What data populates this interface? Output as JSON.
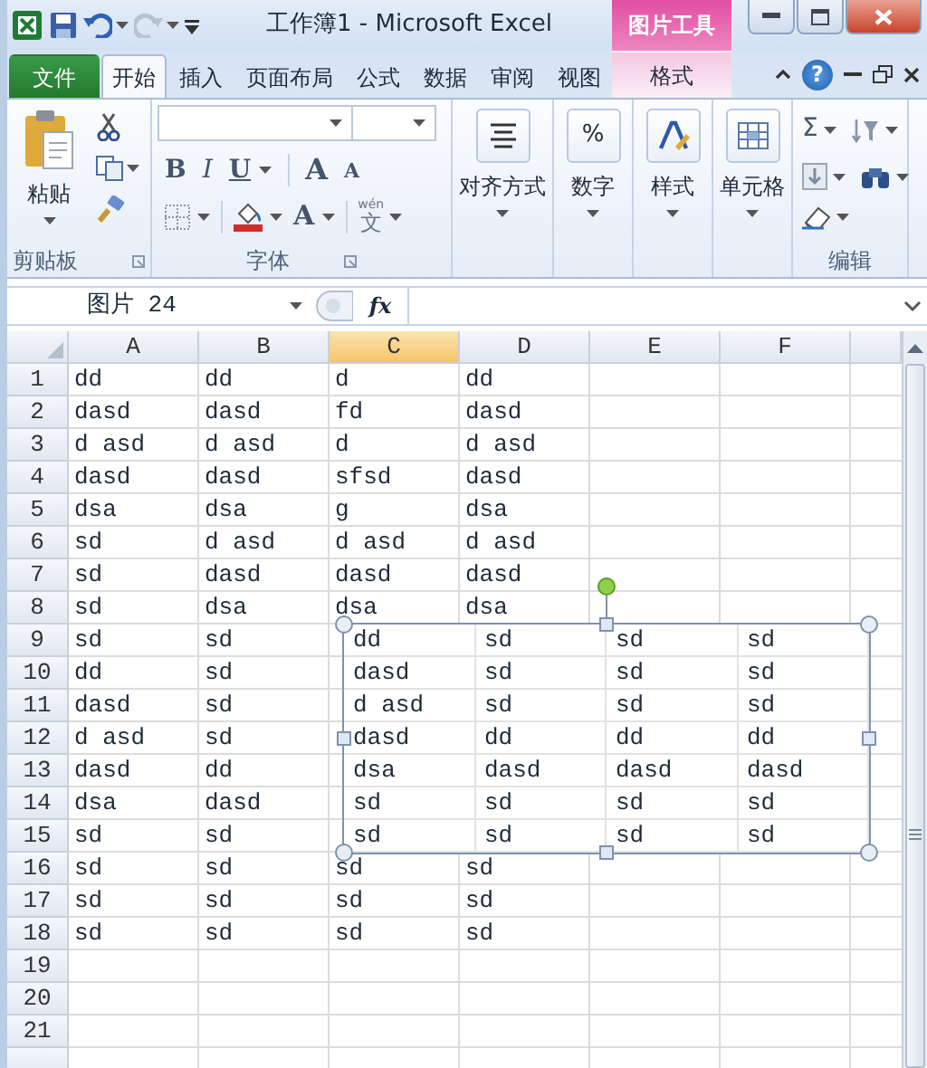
{
  "title_bar": {
    "title": "工作簿1 - Microsoft Excel",
    "context_label": "图片工具"
  },
  "tabs": [
    {
      "label": "文件",
      "kind": "file",
      "selected": false
    },
    {
      "label": "开始",
      "kind": "tab",
      "selected": true
    },
    {
      "label": "插入",
      "kind": "tab",
      "selected": false
    },
    {
      "label": "页面布局",
      "kind": "tab",
      "selected": false
    },
    {
      "label": "公式",
      "kind": "tab",
      "selected": false
    },
    {
      "label": "数据",
      "kind": "tab",
      "selected": false
    },
    {
      "label": "审阅",
      "kind": "tab",
      "selected": false
    },
    {
      "label": "视图",
      "kind": "tab",
      "selected": false
    },
    {
      "label": "格式",
      "kind": "context",
      "selected": false
    }
  ],
  "help_label": "?",
  "ribbon": {
    "clipboard": {
      "paste": "粘贴",
      "label": "剪贴板"
    },
    "font": {
      "label": "字体",
      "bold": "B",
      "italic": "I",
      "underline": "U",
      "grow": "A",
      "shrink": "A",
      "font_color": "A",
      "phonetic": "文",
      "phonetic_ruby": "wén"
    },
    "buttons": [
      {
        "label": "对齐方式",
        "kind": "align"
      },
      {
        "label": "数字",
        "kind": "number",
        "glyph": "%"
      },
      {
        "label": "样式",
        "kind": "styles"
      },
      {
        "label": "单元格",
        "kind": "cells"
      }
    ],
    "editing": {
      "label": "编辑",
      "sum": "Σ"
    }
  },
  "formula_bar": {
    "name_box": "图片 24",
    "fx": "fx"
  },
  "columns": [
    {
      "label": "A",
      "selected": false
    },
    {
      "label": "B",
      "selected": false
    },
    {
      "label": "C",
      "selected": true
    },
    {
      "label": "D",
      "selected": false
    },
    {
      "label": "E",
      "selected": false
    },
    {
      "label": "F",
      "selected": false
    }
  ],
  "rows": [
    {
      "number": "1",
      "cells": [
        "dd",
        "dd",
        "d",
        "dd"
      ]
    },
    {
      "number": "2",
      "cells": [
        "dasd",
        "dasd",
        "fd",
        "dasd"
      ]
    },
    {
      "number": "3",
      "cells": [
        "d asd",
        "d asd",
        "d",
        "d asd"
      ]
    },
    {
      "number": "4",
      "cells": [
        "dasd",
        "dasd",
        "sfsd",
        "dasd"
      ]
    },
    {
      "number": "5",
      "cells": [
        "dsa",
        "dsa",
        "g",
        "dsa"
      ]
    },
    {
      "number": "6",
      "cells": [
        "sd",
        "d asd",
        "d asd",
        "d asd"
      ]
    },
    {
      "number": "7",
      "cells": [
        "sd",
        "dasd",
        "dasd",
        "dasd"
      ]
    },
    {
      "number": "8",
      "cells": [
        "sd",
        "dsa",
        "dsa",
        "dsa"
      ]
    },
    {
      "number": "9",
      "cells": [
        "sd",
        "sd"
      ]
    },
    {
      "number": "10",
      "cells": [
        "dd",
        "sd"
      ]
    },
    {
      "number": "11",
      "cells": [
        "dasd",
        "sd"
      ]
    },
    {
      "number": "12",
      "cells": [
        "d asd",
        "sd"
      ]
    },
    {
      "number": "13",
      "cells": [
        "dasd",
        "dd"
      ]
    },
    {
      "number": "14",
      "cells": [
        "dsa",
        "dasd"
      ]
    },
    {
      "number": "15",
      "cells": [
        "sd",
        "sd"
      ]
    },
    {
      "number": "16",
      "cells": [
        "sd",
        "sd",
        "sd",
        "sd"
      ]
    },
    {
      "number": "17",
      "cells": [
        "sd",
        "sd",
        "sd",
        "sd"
      ]
    },
    {
      "number": "18",
      "cells": [
        "sd",
        "sd",
        "sd",
        "sd"
      ]
    },
    {
      "number": "19",
      "cells": []
    },
    {
      "number": "20",
      "cells": []
    },
    {
      "number": "21",
      "cells": []
    }
  ],
  "picture": {
    "selected": true,
    "rows": [
      [
        "dd",
        "sd",
        "sd",
        "sd"
      ],
      [
        "dasd",
        "sd",
        "sd",
        "sd"
      ],
      [
        "d asd",
        "sd",
        "sd",
        "sd"
      ],
      [
        "dasd",
        "dd",
        "dd",
        "dd"
      ],
      [
        "dsa",
        "dasd",
        "dasd",
        "dasd"
      ],
      [
        "sd",
        "sd",
        "sd",
        "sd"
      ],
      [
        "sd",
        "sd",
        "sd",
        "sd"
      ]
    ]
  }
}
